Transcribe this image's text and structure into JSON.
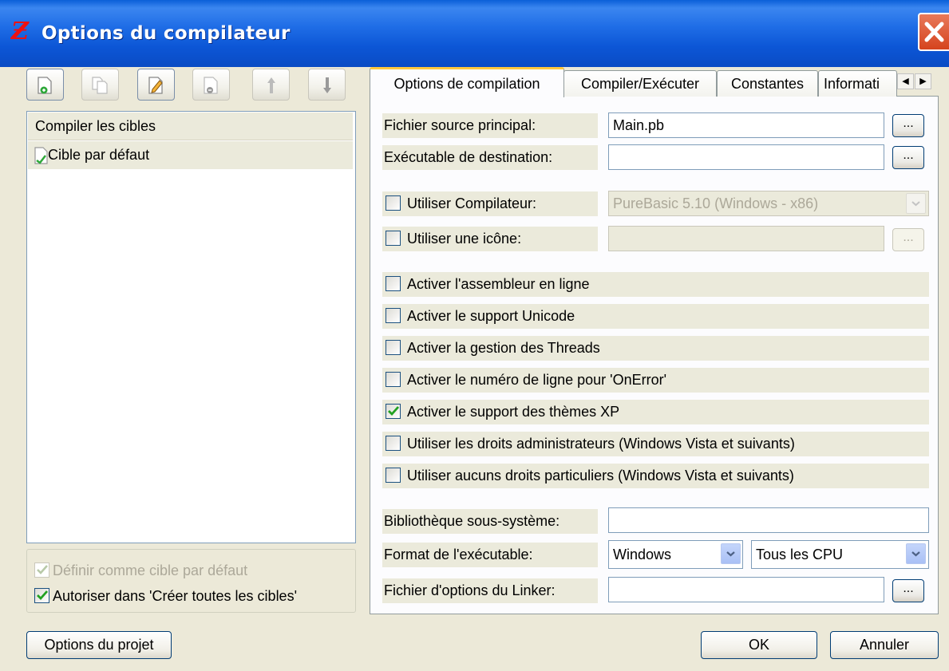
{
  "window": {
    "title": "Options du compilateur",
    "close_icon": "close-icon",
    "app_icon_glyph": "Ƶ"
  },
  "toolbar": {
    "buttons": [
      {
        "icon": "new-target-icon"
      },
      {
        "icon": "copy-target-icon"
      },
      {
        "icon": "edit-target-icon"
      },
      {
        "icon": "remove-target-icon"
      },
      {
        "icon": "move-up-icon"
      },
      {
        "icon": "move-down-icon"
      }
    ]
  },
  "targets": {
    "header": "Compiler les cibles",
    "items": [
      {
        "label": "Cible par défaut",
        "icon": "target-file-icon"
      }
    ]
  },
  "target_options": {
    "set_default_label": "Définir comme cible par défaut",
    "set_default_checked": true,
    "allow_build_all_label": "Autoriser dans 'Créer toutes les cibles'",
    "allow_build_all_checked": true
  },
  "tabs": [
    {
      "label": "Options de compilation",
      "active": true
    },
    {
      "label": "Compiler/Exécuter"
    },
    {
      "label": "Constantes"
    },
    {
      "label": "Informati"
    }
  ],
  "compile_options": {
    "main_source_label": "Fichier source principal:",
    "main_source_value": "Main.pb",
    "output_exe_label": "Exécutable de destination:",
    "output_exe_value": "",
    "browse_label": "...",
    "use_compiler_label": "Utiliser Compilateur:",
    "use_compiler_value": "PureBasic 5.10 (Windows - x86)",
    "use_icon_label": "Utiliser une icône:",
    "use_icon_value": "",
    "flags": [
      {
        "label": "Activer l'assembleur en ligne",
        "checked": false
      },
      {
        "label": "Activer le support Unicode",
        "checked": false
      },
      {
        "label": "Activer la gestion des Threads",
        "checked": false
      },
      {
        "label": "Activer le numéro de ligne pour 'OnError'",
        "checked": false
      },
      {
        "label": "Activer le support des thèmes XP",
        "checked": true
      },
      {
        "label": "Utiliser les droits administrateurs (Windows Vista et suivants)",
        "checked": false
      },
      {
        "label": "Utiliser aucuns droits particuliers (Windows Vista et suivants)",
        "checked": false
      }
    ],
    "subsystem_label": "Bibliothèque sous-système:",
    "subsystem_value": "",
    "exe_format_label": "Format de l'exécutable:",
    "exe_format_value": "Windows",
    "cpu_value": "Tous les CPU",
    "linker_label": "Fichier d'options du Linker:",
    "linker_value": ""
  },
  "footer": {
    "project_options_label": "Options du projet",
    "ok_label": "OK",
    "cancel_label": "Annuler"
  },
  "colors": {
    "titlebar": "#0c56d6",
    "check_green": "#21a121",
    "tab_highlight": "#ffc83c"
  }
}
